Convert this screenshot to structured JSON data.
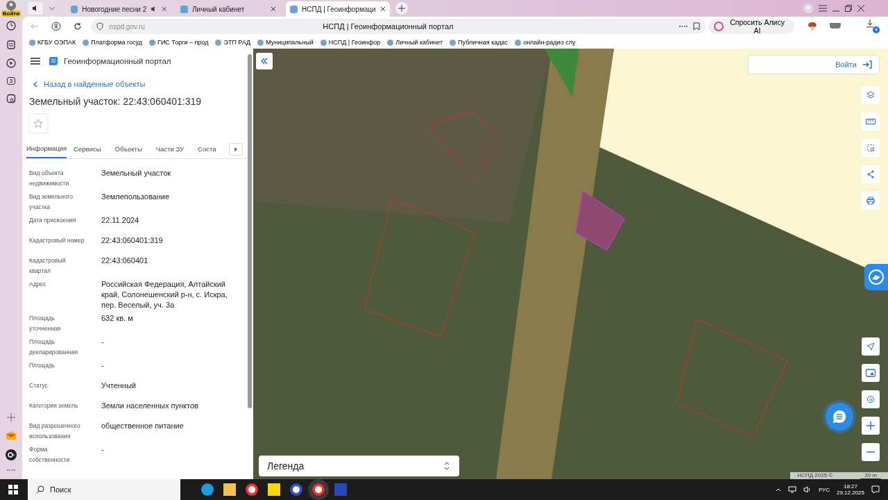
{
  "browser": {
    "account_label": "Войти",
    "tabs": [
      {
        "title": "Новогодние песни 2",
        "audio": true,
        "selected": false
      },
      {
        "title": "Личный кабинет",
        "audio": false,
        "selected": false
      },
      {
        "title": "НСПД | Геоинформаци",
        "audio": false,
        "selected": true
      }
    ],
    "address": "nspd.gov.ru",
    "page_title": "НСПД | Геоинформационный портал",
    "alice_button": "Спросить Алису AI",
    "downloads_badge": "4",
    "bookmarks": [
      "КГБУ ОЭПАК",
      "Платформа госуд",
      "ГИС Торги – прод",
      "ЭТП РАД",
      "Муниципальный",
      "НСПД | Геоинфор",
      "Личный кабинет",
      "Публичная кадас",
      "онлайн-радио слу"
    ],
    "sidebar_badge": "3"
  },
  "panel": {
    "app_title": "Геоинформационный портал",
    "back_link": "Назад в найденные объекты",
    "heading": "Земельный участок: 22:43:060401:319",
    "tabs": [
      {
        "label": "Информация",
        "selected": true
      },
      {
        "label": "Сервисы",
        "selected": false
      },
      {
        "label": "Объекты",
        "selected": false
      },
      {
        "label": "Части ЗУ",
        "selected": false
      },
      {
        "label": "Соста",
        "selected": false
      }
    ],
    "fields": [
      {
        "label": "Вид объекта недвижимости",
        "value": "Земельный участок"
      },
      {
        "label": "Вид земельного участка",
        "value": "Землепользование"
      },
      {
        "label": "Дата присвоения",
        "value": "22.11.2024"
      },
      {
        "label": "Кадастровый номер",
        "value": "22:43:060401:319"
      },
      {
        "label": "Кадастровый квартал",
        "value": "22:43:060401"
      },
      {
        "label": "Адрес",
        "value": "Российская Федерация, Алтайский край, Солонешенский р-н, с. Искра, пер. Веселый, уч. 3а"
      },
      {
        "label": "Площадь уточненная",
        "value": "632 кв. м"
      },
      {
        "label": "Площадь декларированная",
        "value": "-"
      },
      {
        "label": "Площадь",
        "value": "-"
      },
      {
        "label": "Статус",
        "value": "Учтенный"
      },
      {
        "label": "Категория земель",
        "value": "Земли населенных пунктов"
      },
      {
        "label": "Вид разрешенного использования",
        "value": "общественное питание"
      },
      {
        "label": "Форма собственности",
        "value": "-"
      }
    ]
  },
  "map": {
    "login_button": "Войти",
    "legend": "Легенда",
    "attribution": "НСПД 2025 ©",
    "scale": "20 m"
  },
  "taskbar": {
    "search": "Поиск",
    "language": "РУС",
    "time": "18:27",
    "date": "29.12.2025"
  }
}
